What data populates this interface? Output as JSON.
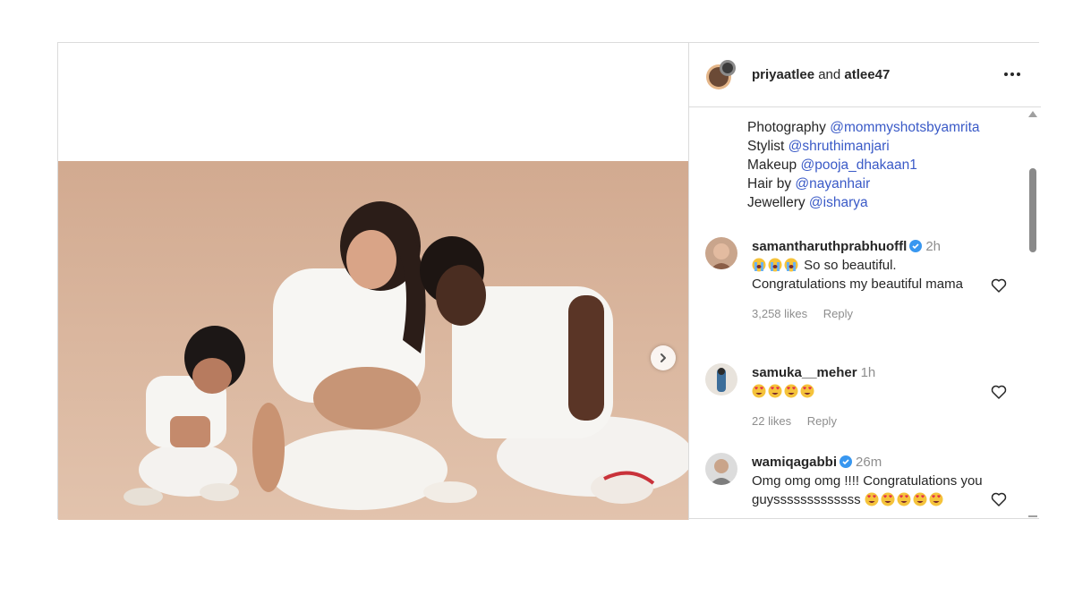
{
  "header": {
    "user1": "priyaatlee",
    "and_text": "and",
    "user2": "atlee47",
    "more_icon": "more-horizontal-icon"
  },
  "credits": [
    {
      "label": "Photography",
      "mention": "@mommyshotsbyamrita"
    },
    {
      "label": "Stylist",
      "mention": "@shruthimanjari"
    },
    {
      "label": "Makeup",
      "mention": "@pooja_dhakaan1"
    },
    {
      "label": "Hair by",
      "mention": "@nayanhair"
    },
    {
      "label": "Jewellery",
      "mention": "@isharya"
    }
  ],
  "comments": [
    {
      "user": "samantharuthprabhuoffl",
      "verified": true,
      "time": "2h",
      "text": "So so beautiful. Congratulations my beautiful mama",
      "emoji_prefix": "loudly-crying-face x3",
      "likes": "3,258 likes",
      "reply": "Reply"
    },
    {
      "user": "samuka__meher",
      "verified": false,
      "time": "1h",
      "emoji": "smiling-face-with-heart-eyes x4",
      "likes": "22 likes",
      "reply": "Reply"
    },
    {
      "user": "wamiqagabbi",
      "verified": true,
      "time": "26m",
      "text": "Omg omg omg !!!! Congratulations you guysssssssssssss",
      "emoji_suffix": "smiling-face-with-heart-eyes x5"
    }
  ],
  "colors": {
    "mention": "#3a5ac7",
    "muted": "#8e8e8e",
    "photo_background": "#d3ad94",
    "verified": "#3897f0"
  }
}
